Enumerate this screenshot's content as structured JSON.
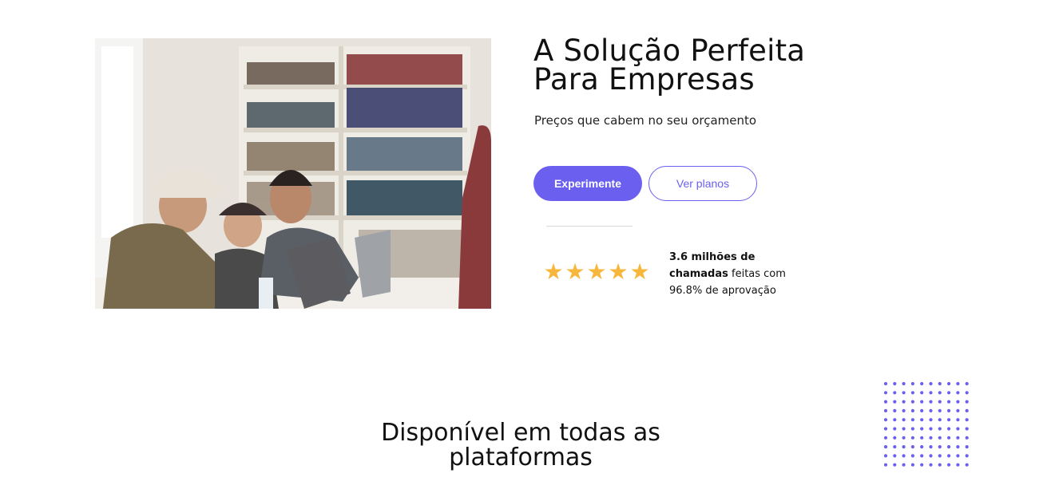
{
  "hero": {
    "image_alt": "Equipe trabalhando em laptops em frente a uma estante de livros",
    "title": "A Solução Perfeita Para Empresas",
    "subtitle": "Preços que cabem no seu orçamento",
    "primary_button": "Experimente",
    "secondary_button": "Ver planos"
  },
  "rating": {
    "stars": 5,
    "star_glyph": "★",
    "star_color": "#f6b73c",
    "stat_bold": "3.6 milhões de chamadas",
    "stat_text": " feitas com 96.8% de aprovação"
  },
  "platforms": {
    "title": "Disponível em todas as plataformas"
  },
  "colors": {
    "accent": "#6a5fef",
    "dots": "#6a5fef"
  }
}
